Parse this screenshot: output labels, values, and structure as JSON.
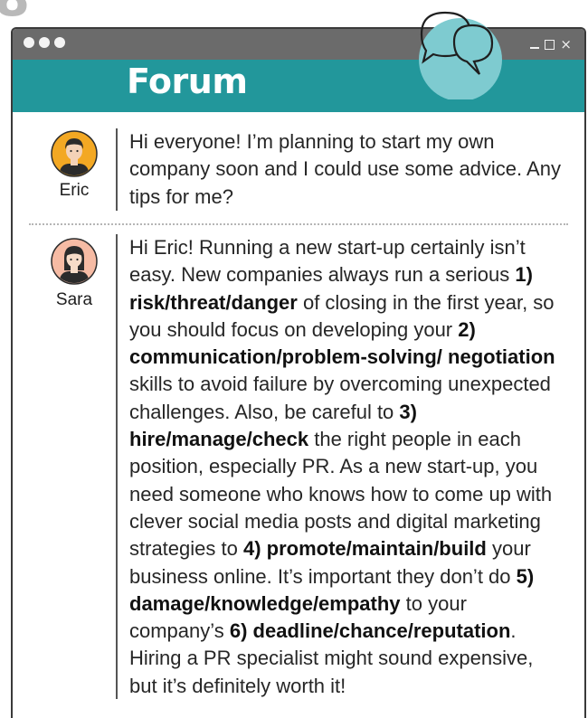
{
  "page_marker": "8",
  "window": {
    "title": "Forum",
    "controls": {
      "close_glyph": "×"
    }
  },
  "colors": {
    "header_teal": "#22979b",
    "titlebar_gray": "#6b6b6b",
    "bubble_fill": "#7ecbd0"
  },
  "posts": [
    {
      "author": "Eric",
      "avatar_bg": "#f3a823",
      "segments": [
        {
          "t": "Hi everyone! I’m planning to start my own company soon and I could use some advice. Any tips for me?",
          "b": false
        }
      ]
    },
    {
      "author": "Sara",
      "avatar_bg": "#f6bba4",
      "segments": [
        {
          "t": "Hi Eric! Running a new start-up certainly isn’t easy. New companies always run a serious ",
          "b": false
        },
        {
          "t": "1) risk/threat/danger",
          "b": true
        },
        {
          "t": " of closing in the first year, so you should focus on developing your ",
          "b": false
        },
        {
          "t": "2) communication/problem-solving/ negotiation",
          "b": true
        },
        {
          "t": " skills to avoid failure by overcoming unexpected challenges. Also, be careful to ",
          "b": false
        },
        {
          "t": "3) hire/manage/check",
          "b": true
        },
        {
          "t": " the right people in each position, especially PR. As a new start-up, you need someone who knows how to come up with clever social media posts and digital marketing strategies to ",
          "b": false
        },
        {
          "t": "4) promote/maintain/build",
          "b": true
        },
        {
          "t": " your business online. It’s important they don’t do ",
          "b": false
        },
        {
          "t": "5) damage/knowledge/empathy",
          "b": true
        },
        {
          "t": " to your company’s ",
          "b": false
        },
        {
          "t": "6) deadline/chance/reputation",
          "b": true
        },
        {
          "t": ". Hiring a PR specialist might sound expensive, but it’s definitely worth it!",
          "b": false
        }
      ]
    }
  ]
}
